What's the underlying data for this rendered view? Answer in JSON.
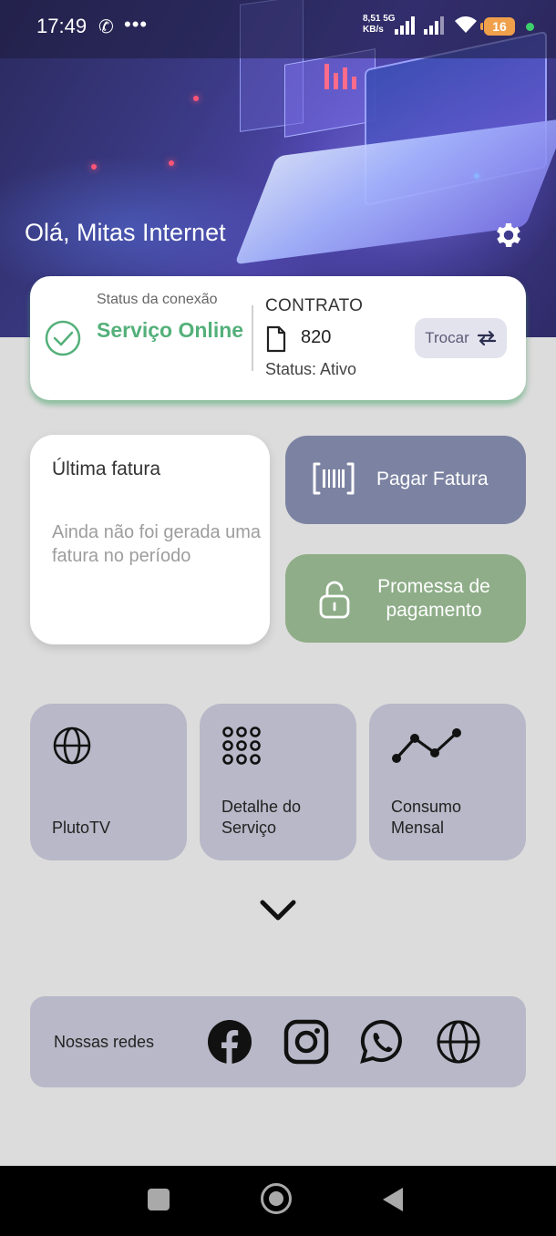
{
  "status_bar": {
    "time": "17:49",
    "network_speed_value": "8,51",
    "network_speed_unit": "KB/s",
    "network_type": "5G",
    "battery": "16",
    "icons": [
      "phone-icon",
      "more-icon",
      "signal-icon",
      "wifi-icon",
      "battery-icon"
    ]
  },
  "header": {
    "greeting": "Olá, Mitas Internet",
    "settings_icon": "gear-icon"
  },
  "connection": {
    "label": "Status da conexão",
    "value": "Serviço Online",
    "icon": "check-circle-icon",
    "color": "#54b07a"
  },
  "contract": {
    "label": "CONTRATO",
    "number": "820",
    "status": "Status: Ativo",
    "switch_label": "Trocar",
    "icon": "document-icon"
  },
  "invoice": {
    "title": "Última fatura",
    "message": "Ainda não foi gerada uma fatura no período"
  },
  "actions": {
    "pay_label": "Pagar Fatura",
    "pay_icon": "barcode-icon",
    "pay_color": "#7c83a2",
    "promise_label": "Promessa de pagamento",
    "promise_icon": "unlock-icon",
    "promise_color": "#8ead88"
  },
  "tiles": [
    {
      "label": "PlutoTV",
      "icon": "globe-icon"
    },
    {
      "label": "Detalhe do Serviço",
      "icon": "grid-dots-icon"
    },
    {
      "label": "Consumo Mensal",
      "icon": "line-chart-icon"
    }
  ],
  "more_icon": "chevron-down-icon",
  "social": {
    "label": "Nossas redes",
    "icons": [
      "facebook-icon",
      "instagram-icon",
      "whatsapp-icon",
      "website-globe-icon"
    ]
  },
  "nav": {
    "icons": [
      "recents-square-icon",
      "home-circle-icon",
      "back-triangle-icon"
    ]
  }
}
